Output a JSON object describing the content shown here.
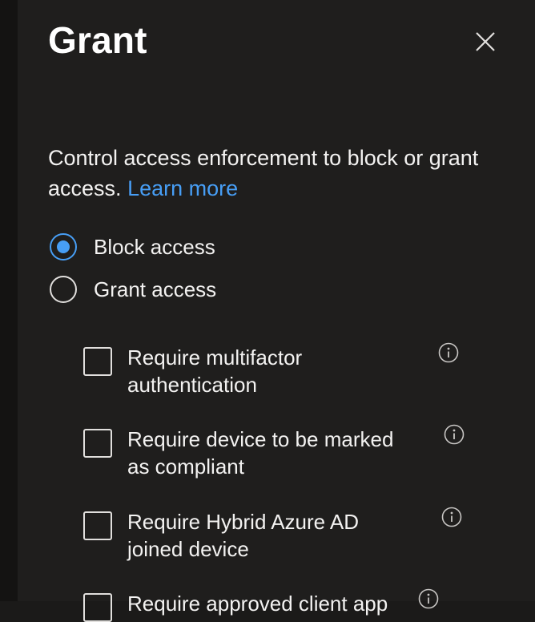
{
  "panel": {
    "title": "Grant",
    "description": "Control access enforcement to block or grant access.",
    "learn_more": "Learn more"
  },
  "access": {
    "options": [
      {
        "label": "Block access",
        "selected": true
      },
      {
        "label": "Grant access",
        "selected": false
      }
    ]
  },
  "controls": {
    "items": [
      {
        "label": "Require multifactor authentication",
        "checked": false
      },
      {
        "label": "Require device to be marked as compliant",
        "checked": false
      },
      {
        "label": "Require Hybrid Azure AD joined device",
        "checked": false
      },
      {
        "label": "Require approved client app",
        "checked": false
      }
    ]
  },
  "colors": {
    "background": "#1f1e1d",
    "accent": "#479ef5",
    "text": "#f3f2f1"
  },
  "icons": {
    "close": "close-icon",
    "info": "info-icon"
  }
}
